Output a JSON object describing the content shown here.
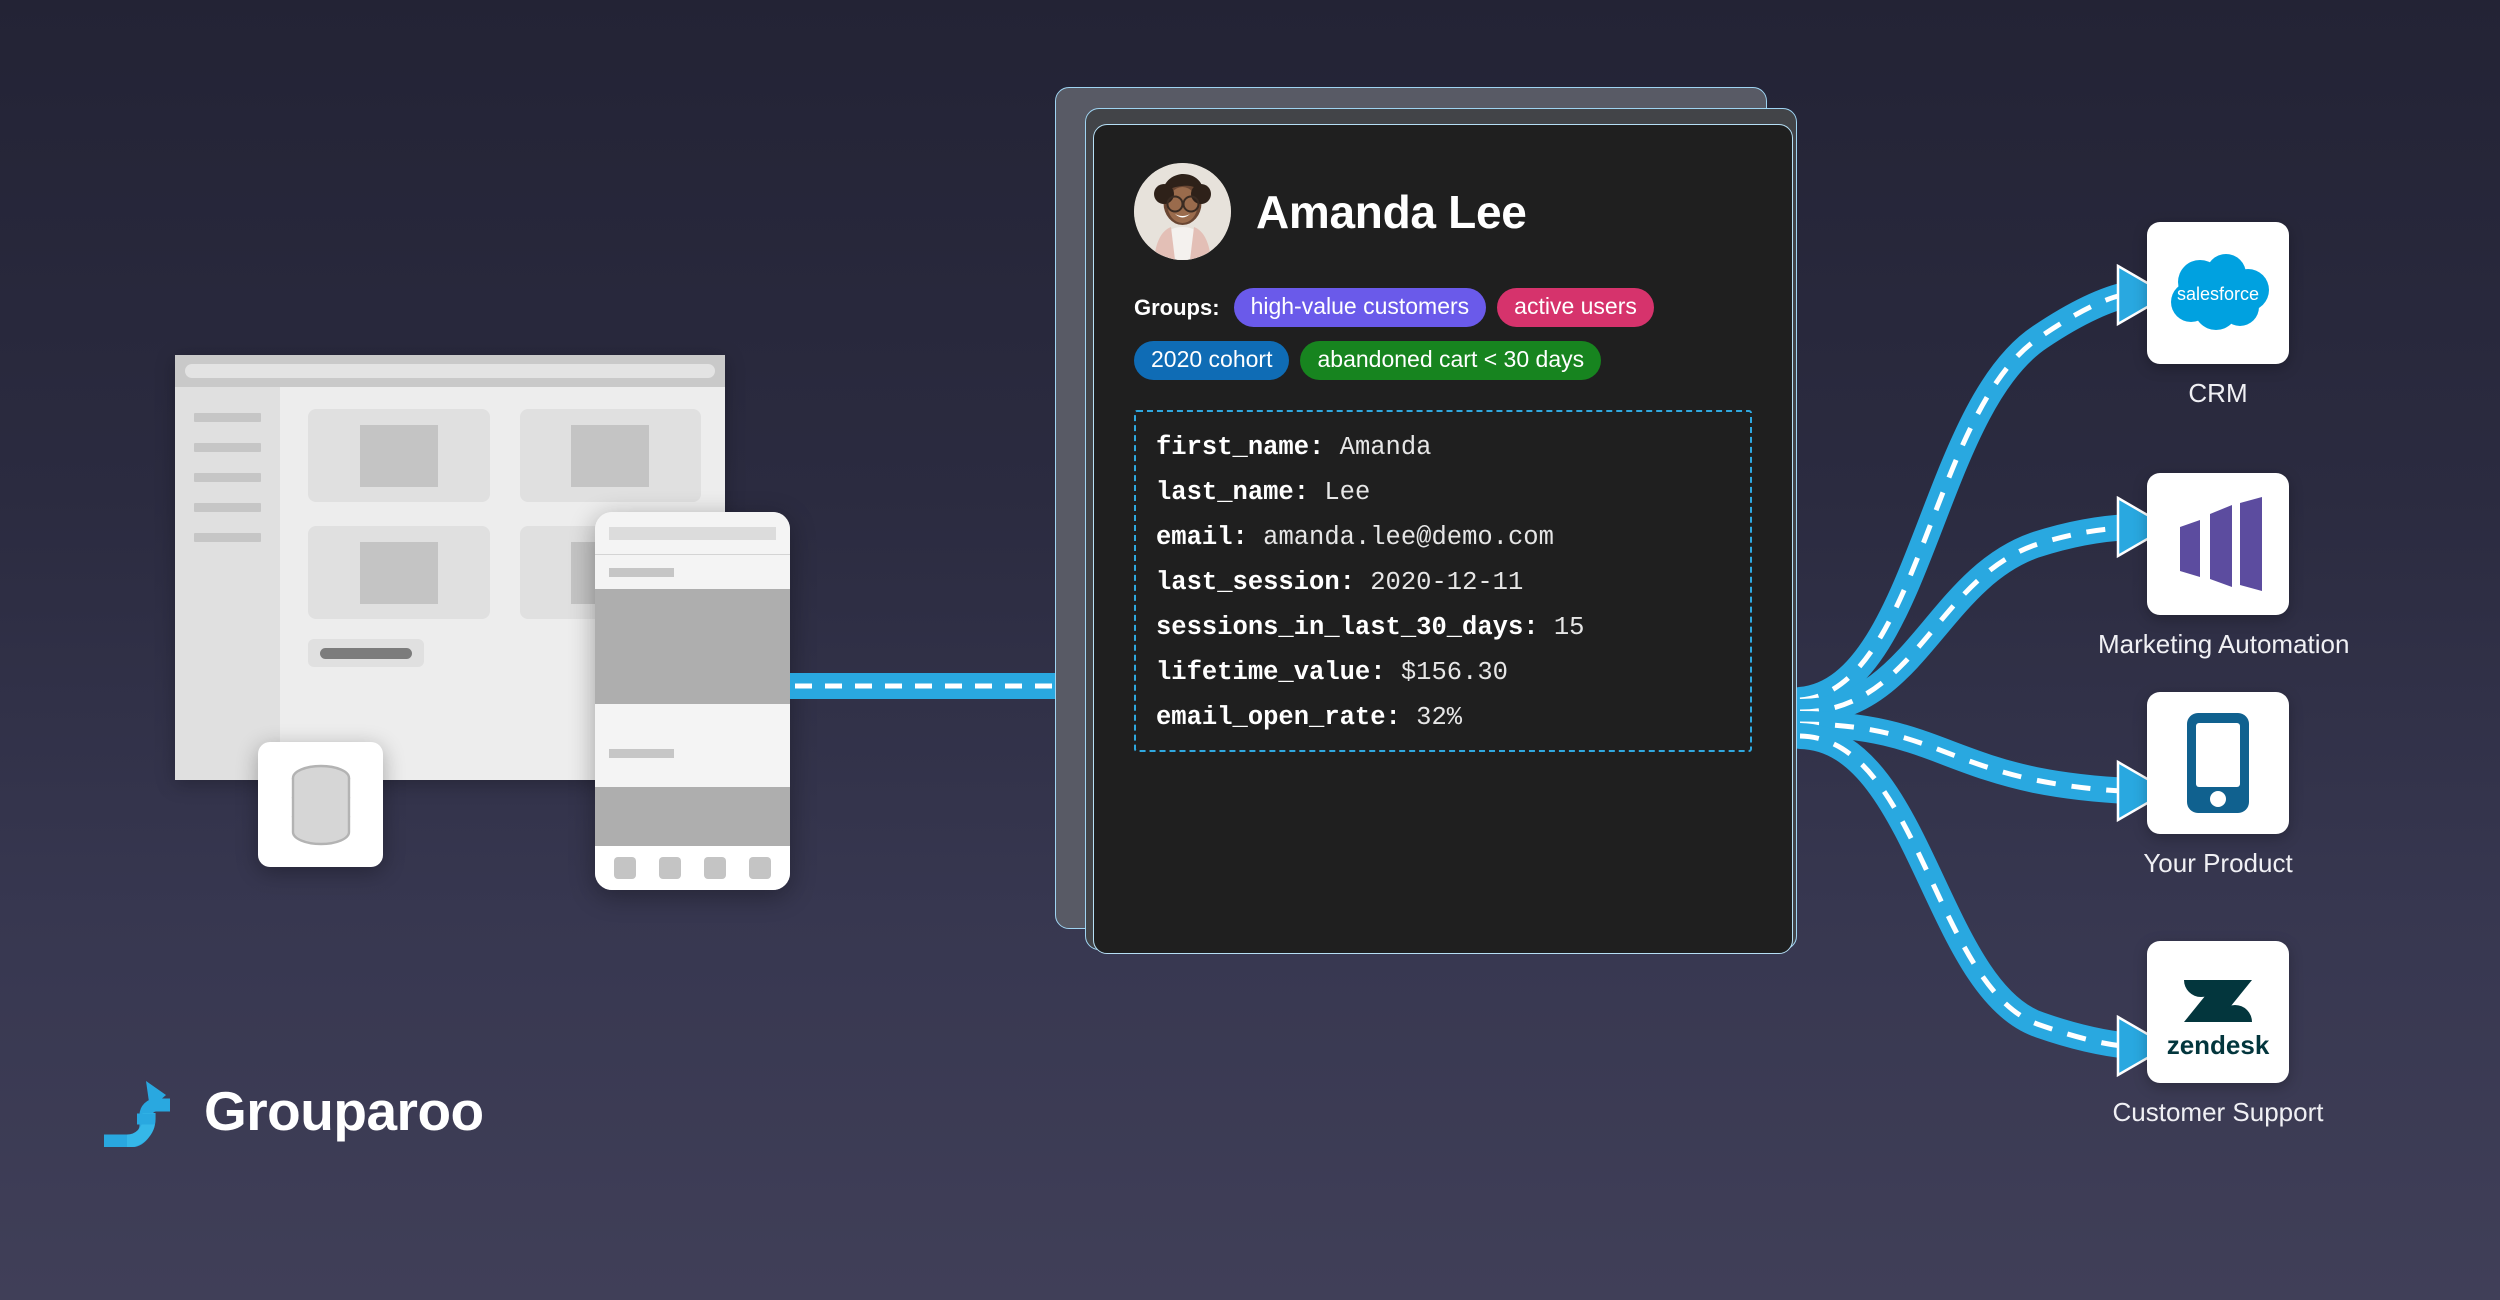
{
  "brand": {
    "name": "Grouparoo",
    "logo_icon": "grouparoo-kangaroo-g-icon",
    "accent": "#29a8e0"
  },
  "background": {
    "top": "#232335",
    "bottom": "#403f58"
  },
  "sources": {
    "browser_icon": "browser-window-wireframe",
    "database_icon": "database-cylinder-icon",
    "phone_icon": "mobile-phone-wireframe"
  },
  "profile": {
    "name": "Amanda Lee",
    "avatar_icon": "user-photo-avatar",
    "groups_label": "Groups:",
    "groups": [
      {
        "label": "high-value customers",
        "color": "#6a5aea"
      },
      {
        "label": "active users",
        "color": "#d6336c"
      },
      {
        "label": "2020 cohort",
        "color": "#0f6cb5"
      },
      {
        "label": "abandoned cart < 30 days",
        "color": "#17841f"
      }
    ],
    "properties": [
      {
        "key": "first_name:",
        "value": "Amanda"
      },
      {
        "key": "last_name:",
        "value": "Lee"
      },
      {
        "key": "email:",
        "value": "amanda.lee@demo.com"
      },
      {
        "key": "last_session:",
        "value": "2020-12-11"
      },
      {
        "key": "sessions_in_last_30_days:",
        "value": "15"
      },
      {
        "key": "lifetime_value:",
        "value": "$156.30"
      },
      {
        "key": "email_open_rate:",
        "value": "32%"
      }
    ]
  },
  "destinations": [
    {
      "label": "CRM",
      "logo_icon": "salesforce-cloud-icon",
      "brand_color": "#00a1e0",
      "logo_text": "salesforce"
    },
    {
      "label": "Marketing Automation",
      "logo_icon": "marketo-panels-icon",
      "brand_color": "#5c4c9f"
    },
    {
      "label": "Your Product",
      "logo_icon": "mobile-device-icon",
      "brand_color": "#10618f"
    },
    {
      "label": "Customer Support",
      "logo_icon": "zendesk-icon",
      "brand_color": "#03363d",
      "logo_text": "zendesk"
    }
  ],
  "flow": {
    "arrow_color": "#29a8e0",
    "dash_color": "#ffffff"
  }
}
